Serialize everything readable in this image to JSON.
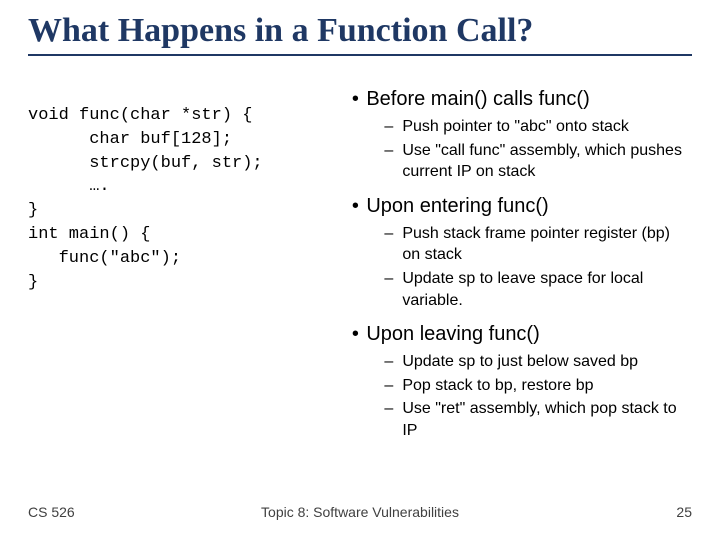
{
  "title": "What Happens in a Function Call?",
  "code": "void func(char *str) {\n      char buf[128];\n      strcpy(buf, str);\n      ….\n}\nint main() {\n   func(\"abc\");\n}",
  "bullets": {
    "b1": {
      "label": "Before main() calls func()",
      "sub": {
        "s1": "Push pointer to \"abc\" onto stack",
        "s2": "Use \"call func\" assembly, which pushes current IP on stack"
      }
    },
    "b2": {
      "label": "Upon entering func()",
      "sub": {
        "s1": "Push stack frame pointer register (bp) on stack",
        "s2": "Update sp to leave space for local variable."
      }
    },
    "b3": {
      "label": "Upon leaving func()",
      "sub": {
        "s1": "Update sp to just below saved bp",
        "s2": "Pop stack to bp, restore bp",
        "s3": "Use \"ret\" assembly, which pop stack to IP"
      }
    }
  },
  "footer": {
    "left": "CS 526",
    "center": "Topic 8: Software Vulnerabilities",
    "right": "25"
  }
}
